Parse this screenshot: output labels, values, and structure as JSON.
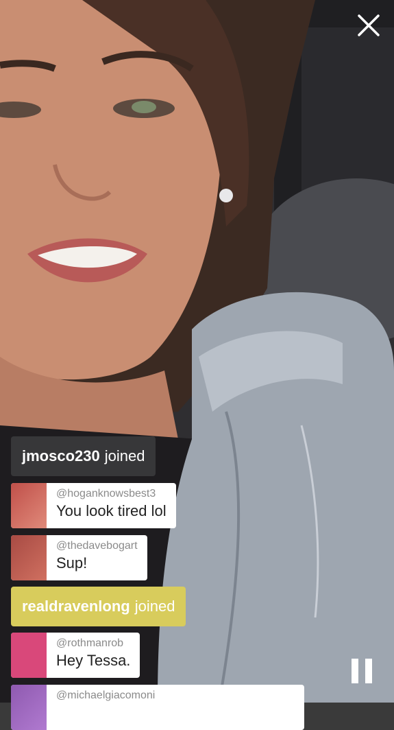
{
  "stream": {
    "close_icon": "close-icon",
    "pause_icon": "pause-icon"
  },
  "chat": {
    "events": [
      {
        "type": "joined",
        "user": "jmosco230",
        "label": "joined",
        "style": "dark"
      },
      {
        "type": "message",
        "handle": "@hoganknowsbest3",
        "text": "You look tired lol",
        "avatar_color": "#c0504a"
      },
      {
        "type": "message",
        "handle": "@thedavebogart",
        "text": "Sup!",
        "avatar_color": "#a84b44"
      },
      {
        "type": "joined",
        "user": "realdravenlong",
        "label": "joined",
        "style": "yellow"
      },
      {
        "type": "message",
        "handle": "@rothmanrob",
        "text": "Hey Tessa.",
        "avatar_color": "#d9487a"
      },
      {
        "type": "message",
        "handle": "@michaelgiacomoni",
        "text": "",
        "avatar_color": "#8f5ab0"
      }
    ]
  }
}
